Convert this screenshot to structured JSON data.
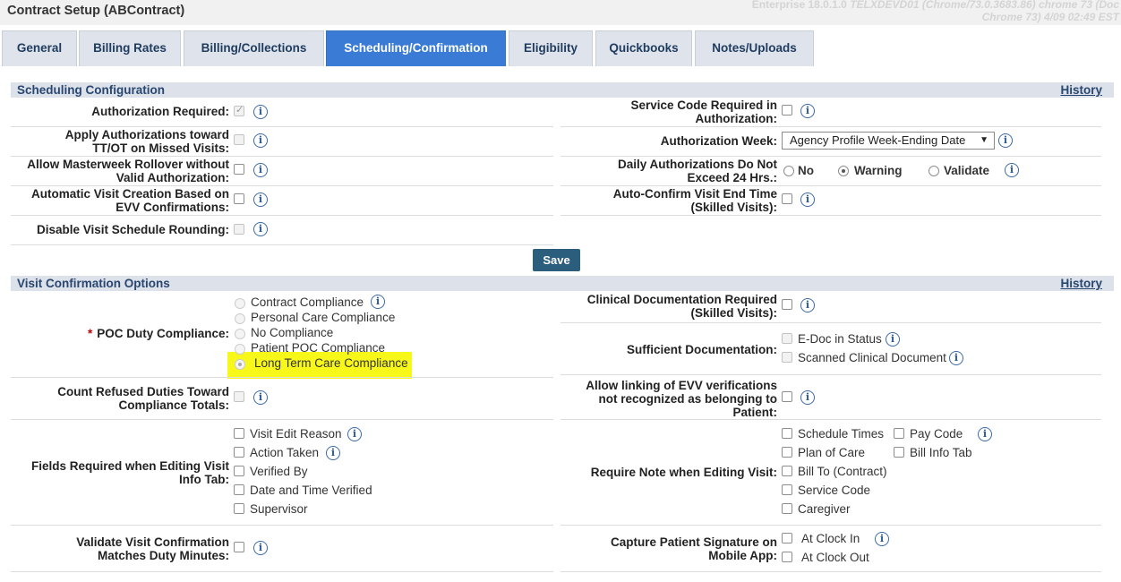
{
  "app": {
    "title": "Contract Setup (ABContract)",
    "env_line1": "Enterprise 18.0.1.0",
    "env_line1_italic": "TELXDEVD01 (Chrome/73.0.3683.86) chrome 73 (Doc",
    "env_line2": "Chrome 73) 4/09 02:49 EST"
  },
  "tabs": [
    {
      "label": "General"
    },
    {
      "label": "Billing Rates"
    },
    {
      "label": "Billing/Collections"
    },
    {
      "label": "Scheduling/Confirmation",
      "active": true
    },
    {
      "label": "Eligibility"
    },
    {
      "label": "Quickbooks"
    },
    {
      "label": "Notes/Uploads"
    }
  ],
  "colors": {
    "active_tab": "#3a7bd5",
    "section_bar": "#dde2ea",
    "save_button": "#2b5d7d",
    "highlight": "#f7f71a"
  },
  "info_icon_glyph": "i",
  "scheduling": {
    "title": "Scheduling Configuration",
    "history": "History",
    "authorization_required": "Authorization Required:",
    "apply_auth_l1": "Apply Authorizations toward",
    "apply_auth_l2": "TT/OT on Missed Visits:",
    "masterweek_l1": "Allow Masterweek Rollover without",
    "masterweek_l2": "Valid Authorization:",
    "auto_visit_l1": "Automatic Visit Creation Based on",
    "auto_visit_l2": "EVV Confirmations:",
    "disable_rounding": "Disable Visit Schedule Rounding:",
    "service_code_l1": "Service Code Required in",
    "service_code_l2": "Authorization:",
    "auth_week_label": "Authorization Week:",
    "auth_week_value": "Agency Profile Week-Ending Date",
    "daily_auth_l1": "Daily Authorizations Do Not",
    "daily_auth_l2": "Exceed 24 Hrs.:",
    "daily_auth_options": [
      "No",
      "Warning",
      "Validate"
    ],
    "daily_auth_selected": "Warning",
    "auto_confirm_l1": "Auto-Confirm Visit End Time",
    "auto_confirm_l2": "(Skilled Visits):",
    "save": "Save"
  },
  "confirmation": {
    "title": "Visit Confirmation Options",
    "history": "History",
    "poc_label": "POC Duty Compliance:",
    "poc_required_mark": "*",
    "poc_options": [
      "Contract Compliance",
      "Personal Care Compliance",
      "No Compliance",
      "Patient POC Compliance",
      "Long Term Care Compliance"
    ],
    "poc_selected": "Long Term Care Compliance",
    "count_refused_l1": "Count Refused Duties Toward",
    "count_refused_l2": "Compliance Totals:",
    "fields_required_l1": "Fields Required when Editing Visit",
    "fields_required_l2": "Info Tab:",
    "fields_required_options": [
      "Visit Edit Reason",
      "Action Taken",
      "Verified By",
      "Date and Time Verified",
      "Supervisor"
    ],
    "validate_l1": "Validate Visit Confirmation",
    "validate_l2": "Matches Duty Minutes:",
    "clinical_doc_l1": "Clinical Documentation Required",
    "clinical_doc_l2": "(Skilled Visits):",
    "sufficient_doc_label": "Sufficient Documentation:",
    "sufficient_doc_options": [
      "E-Doc in Status",
      "Scanned Clinical Document"
    ],
    "allow_linking_l1": "Allow linking of EVV verifications",
    "allow_linking_l2": "not recognized as belonging to",
    "allow_linking_l3": "Patient:",
    "require_note_label": "Require Note when Editing Visit:",
    "require_note_col1": [
      "Schedule Times",
      "Plan of Care",
      "Bill To (Contract)",
      "Service Code",
      "Caregiver"
    ],
    "require_note_col2": [
      "Pay Code",
      "Bill Info Tab"
    ],
    "capture_sig_l1": "Capture Patient Signature on",
    "capture_sig_l2": "Mobile App:",
    "capture_sig_options": [
      "At Clock In",
      "At Clock Out"
    ]
  }
}
